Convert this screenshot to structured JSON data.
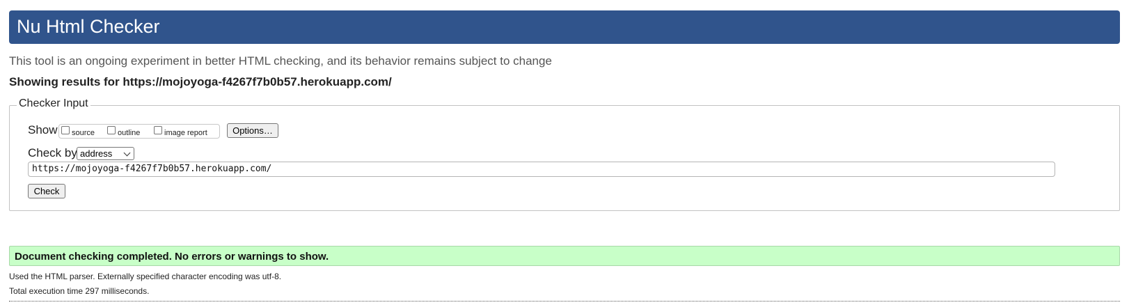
{
  "header": {
    "title": "Nu Html Checker"
  },
  "intro_text": "This tool is an ongoing experiment in better HTML checking, and its behavior remains subject to change",
  "showing_results": "Showing results for https://mojoyoga-f4267f7b0b57.herokuapp.com/",
  "checker_input": {
    "legend": "Checker Input",
    "show_label": "Show",
    "options": [
      {
        "label": "source",
        "checked": false
      },
      {
        "label": "outline",
        "checked": false
      },
      {
        "label": "image report",
        "checked": false
      }
    ],
    "options_button": "Options…",
    "check_by_label": "Check by",
    "check_by_selected": "address",
    "url_value": "https://mojoyoga-f4267f7b0b57.herokuapp.com/",
    "check_button": "Check"
  },
  "result": {
    "success_message": "Document checking completed. No errors or warnings to show.",
    "parser_info": "Used the HTML parser. Externally specified character encoding was utf-8.",
    "execution_time": "Total execution time 297 milliseconds."
  },
  "colors": {
    "header_bg": "#30548c",
    "success_bg": "#c8ffc8"
  }
}
